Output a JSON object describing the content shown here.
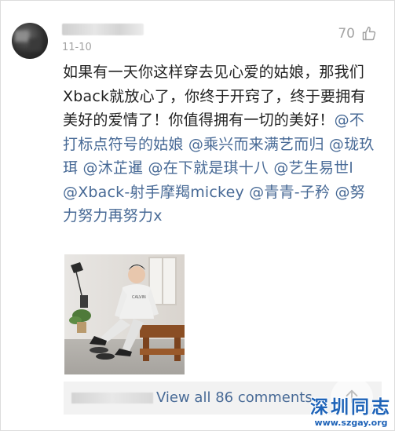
{
  "comment": {
    "date": "11-10",
    "like_count": "70",
    "text_segments": [
      {
        "type": "text",
        "value": "如果有一天你这样穿去见心爱的姑娘，那我们Xback就放心了，你终于开窍了，终于要拥有美好的爱情了！你值得拥有一切的美好！"
      },
      {
        "type": "mention",
        "value": "@不打标点符号的姑娘"
      },
      {
        "type": "text",
        "value": " "
      },
      {
        "type": "mention",
        "value": "@乘兴而来满艺而归"
      },
      {
        "type": "text",
        "value": " "
      },
      {
        "type": "mention",
        "value": "@珑玖珥"
      },
      {
        "type": "text",
        "value": " "
      },
      {
        "type": "mention",
        "value": "@沐芷暹"
      },
      {
        "type": "text",
        "value": " "
      },
      {
        "type": "mention",
        "value": "@在下就是琪十八"
      },
      {
        "type": "text",
        "value": " "
      },
      {
        "type": "mention",
        "value": "@艺生易世l"
      },
      {
        "type": "text",
        "value": " "
      },
      {
        "type": "mention",
        "value": "@Xback-射手摩羯mickey"
      },
      {
        "type": "text",
        "value": " "
      },
      {
        "type": "mention",
        "value": "@青青-子矜"
      },
      {
        "type": "text",
        "value": " "
      },
      {
        "type": "mention",
        "value": "@努力努力再努力x"
      }
    ],
    "photo_caption_text": "CALVIN",
    "replies_link": "View all 86 comments"
  },
  "icons": {
    "like": "thumb-up-icon",
    "scroll_top": "arrow-up-icon"
  },
  "watermark": {
    "title": "深圳同志",
    "url": "www.szgay.org"
  },
  "colors": {
    "mention": "#486a96",
    "body_text": "#222222",
    "meta_text": "#a3a3a3",
    "watermark": "#1e63b8"
  }
}
